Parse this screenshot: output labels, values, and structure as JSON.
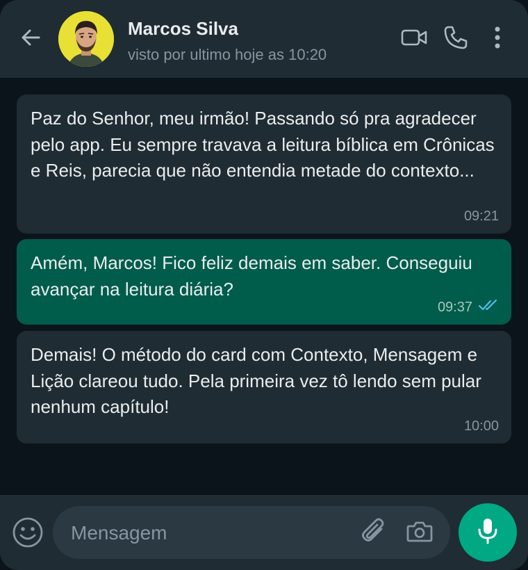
{
  "header": {
    "contact_name": "Marcos Silva",
    "status": "visto por ultimo hoje as 10:20",
    "icons": [
      "back-arrow-icon",
      "video-call-icon",
      "phone-icon",
      "more-options-icon"
    ]
  },
  "messages": [
    {
      "direction": "incoming",
      "text": "Paz do Senhor, meu irmão! Passando só pra agradecer pelo app. Eu sempre travava a leitura bíblica em Crônicas e Reis, parecia que não entendia metade do contexto...",
      "time": "09:21"
    },
    {
      "direction": "outgoing",
      "text": "Amém, Marcos! Fico feliz demais em saber. Conseguiu avançar na leitura diária?",
      "time": "09:37",
      "status_icon": "double-check-read-icon"
    },
    {
      "direction": "incoming",
      "text": "Demais! O método do card com Contexto, Mensagem e Lição clareou tudo. Pela primeira vez tô lendo sem pular nenhum capítulo!",
      "time": "10:00"
    }
  ],
  "composer": {
    "placeholder": "Mensagem",
    "value": "",
    "icons": [
      "emoji-icon",
      "attach-icon",
      "camera-icon",
      "mic-icon"
    ]
  },
  "colors": {
    "header_bg": "#1f2c34",
    "chat_bg": "#0b141a",
    "incoming_bubble": "#202c33",
    "outgoing_bubble": "#005c4b",
    "accent": "#00a884",
    "read_check": "#53bdeb",
    "avatar_bg": "#e8e034"
  }
}
